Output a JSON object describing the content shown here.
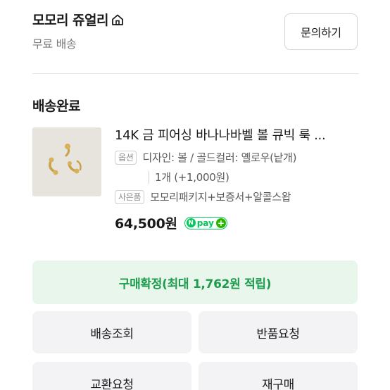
{
  "store": {
    "name": "모모리 쥬얼리",
    "shipping_note": "무료 배송",
    "inquiry_label": "문의하기"
  },
  "order": {
    "status": "배송완료",
    "product": {
      "title": "14K 금 피어싱 바나나바벨 볼 큐빅 룩 ...",
      "option_tag": "옵션",
      "option_text": "디자인: 볼 / 골드컬러: 옐로우(낱개)",
      "quantity_text": "1개 (+1,000원)",
      "gift_tag": "사은품",
      "gift_text": "모모리패키지+보증서+알콜스왑",
      "price": "64,500원",
      "npay_n": "N",
      "npay_label": "pay",
      "npay_plus": "+"
    }
  },
  "actions": {
    "confirm_label": "구매확정(최대 1,762원 적립)",
    "track_label": "배송조회",
    "return_label": "반품요청",
    "exchange_label": "교환요청",
    "reorder_label": "재구매"
  },
  "colors": {
    "accent_green": "#1e9c4d",
    "confirm_bg": "#e8f6ec",
    "npay_green": "#03c75a"
  },
  "icons": {
    "store_home": "home-icon"
  }
}
